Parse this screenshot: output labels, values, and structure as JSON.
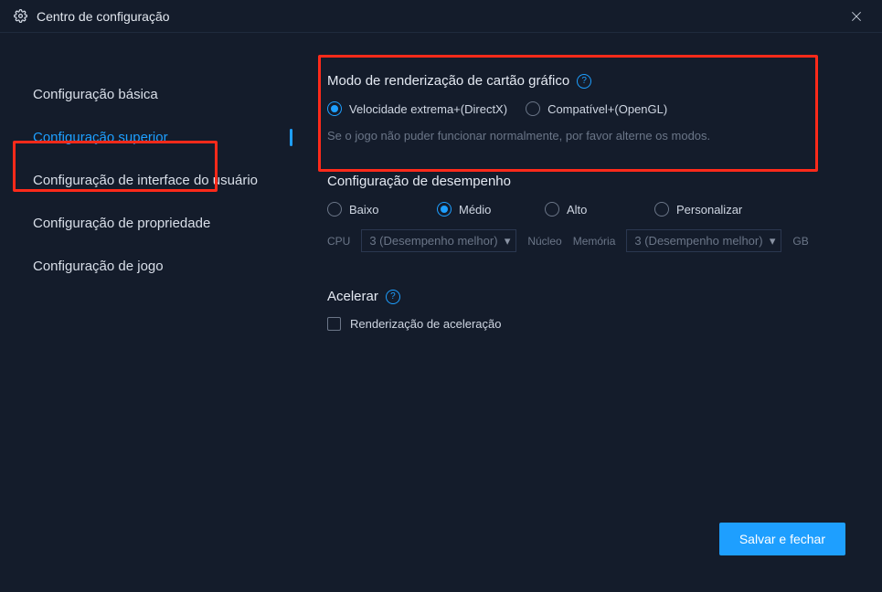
{
  "window": {
    "title": "Centro de configuração"
  },
  "sidebar": {
    "items": [
      {
        "label": "Configuração básica"
      },
      {
        "label": "Configuração superior"
      },
      {
        "label": "Configuração de interface do usuário"
      },
      {
        "label": "Configuração de propriedade"
      },
      {
        "label": "Configuração de jogo"
      }
    ],
    "active_index": 1
  },
  "render_mode": {
    "title": "Modo de renderização de cartão gráfico",
    "options": [
      {
        "label": "Velocidade extrema+(DirectX)",
        "selected": true
      },
      {
        "label": "Compatível+(OpenGL)",
        "selected": false
      }
    ],
    "hint": "Se o jogo não puder funcionar normalmente, por favor alterne os modos."
  },
  "performance": {
    "title": "Configuração de desempenho",
    "options": [
      {
        "label": "Baixo",
        "selected": false
      },
      {
        "label": "Médio",
        "selected": true
      },
      {
        "label": "Alto",
        "selected": false
      },
      {
        "label": "Personalizar",
        "selected": false
      }
    ],
    "cpu_label": "CPU",
    "cpu_value": "3 (Desempenho melhor)",
    "core_label": "Núcleo",
    "memory_label": "Memória",
    "memory_value": "3 (Desempenho melhor)",
    "memory_unit": "GB"
  },
  "accelerate": {
    "title": "Acelerar",
    "checkbox_label": "Renderização de aceleração",
    "checked": false
  },
  "buttons": {
    "save": "Salvar e fechar"
  }
}
